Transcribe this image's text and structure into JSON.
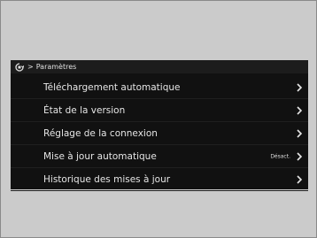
{
  "header": {
    "icon": "settings-icon",
    "separator": ">",
    "title": "Paramètres"
  },
  "menu": {
    "items": [
      {
        "label": "Téléchargement automatique",
        "value": ""
      },
      {
        "label": "État de la version",
        "value": ""
      },
      {
        "label": "Réglage de la connexion",
        "value": ""
      },
      {
        "label": "Mise à jour automatique",
        "value": "Désact."
      },
      {
        "label": "Historique des mises à jour",
        "value": ""
      }
    ]
  }
}
